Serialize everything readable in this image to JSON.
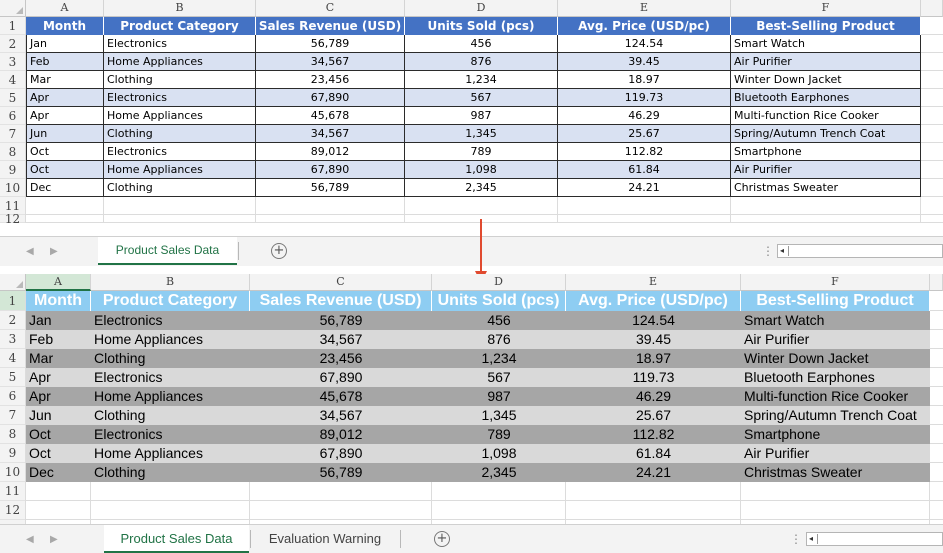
{
  "columns": [
    "A",
    "B",
    "C",
    "D",
    "E",
    "F"
  ],
  "headers": [
    "Month",
    "Product Category",
    "Sales Revenue (USD)",
    "Units Sold (pcs)",
    "Avg. Price (USD/pc)",
    "Best-Selling Product"
  ],
  "rows": [
    [
      "Jan",
      "Electronics",
      "56,789",
      "456",
      "124.54",
      "Smart Watch"
    ],
    [
      "Feb",
      "Home Appliances",
      "34,567",
      "876",
      "39.45",
      "Air Purifier"
    ],
    [
      "Mar",
      "Clothing",
      "23,456",
      "1,234",
      "18.97",
      "Winter Down Jacket"
    ],
    [
      "Apr",
      "Electronics",
      "67,890",
      "567",
      "119.73",
      "Bluetooth Earphones"
    ],
    [
      "Apr",
      "Home Appliances",
      "45,678",
      "987",
      "46.29",
      "Multi-function Rice Cooker"
    ],
    [
      "Jun",
      "Clothing",
      "34,567",
      "1,345",
      "25.67",
      "Spring/Autumn Trench Coat"
    ],
    [
      "Oct",
      "Electronics",
      "89,012",
      "789",
      "112.82",
      "Smartphone"
    ],
    [
      "Oct",
      "Home Appliances",
      "67,890",
      "1,098",
      "61.84",
      "Air Purifier"
    ],
    [
      "Dec",
      "Clothing",
      "56,789",
      "2,345",
      "24.21",
      "Christmas Sweater"
    ]
  ],
  "row_numbers_top": [
    "1",
    "2",
    "3",
    "4",
    "5",
    "6",
    "7",
    "8",
    "9",
    "10",
    "11",
    "12"
  ],
  "row_numbers_bottom": [
    "1",
    "2",
    "3",
    "4",
    "5",
    "6",
    "7",
    "8",
    "9",
    "10",
    "11",
    "12"
  ],
  "top_tabs": {
    "active": "Product Sales Data",
    "add_icon": "plus-circle-icon"
  },
  "bottom_tabs": {
    "active": "Product Sales Data",
    "inactive": "Evaluation Warning",
    "add_icon": "plus-circle-icon"
  },
  "nav": {
    "prev": "◀",
    "next": "▶",
    "menu": "⋮",
    "add": "+",
    "scroll_left": "◂"
  },
  "colors": {
    "top_header_bg": "#4472c4",
    "top_stripe_bg": "#d9e1f2",
    "bottom_header_bg": "#8ecdf2",
    "bottom_dark_bg": "#a6a6a6",
    "bottom_light_bg": "#d9d9d9",
    "active_tab_green": "#217346",
    "arrow_red": "#e04a2f"
  }
}
